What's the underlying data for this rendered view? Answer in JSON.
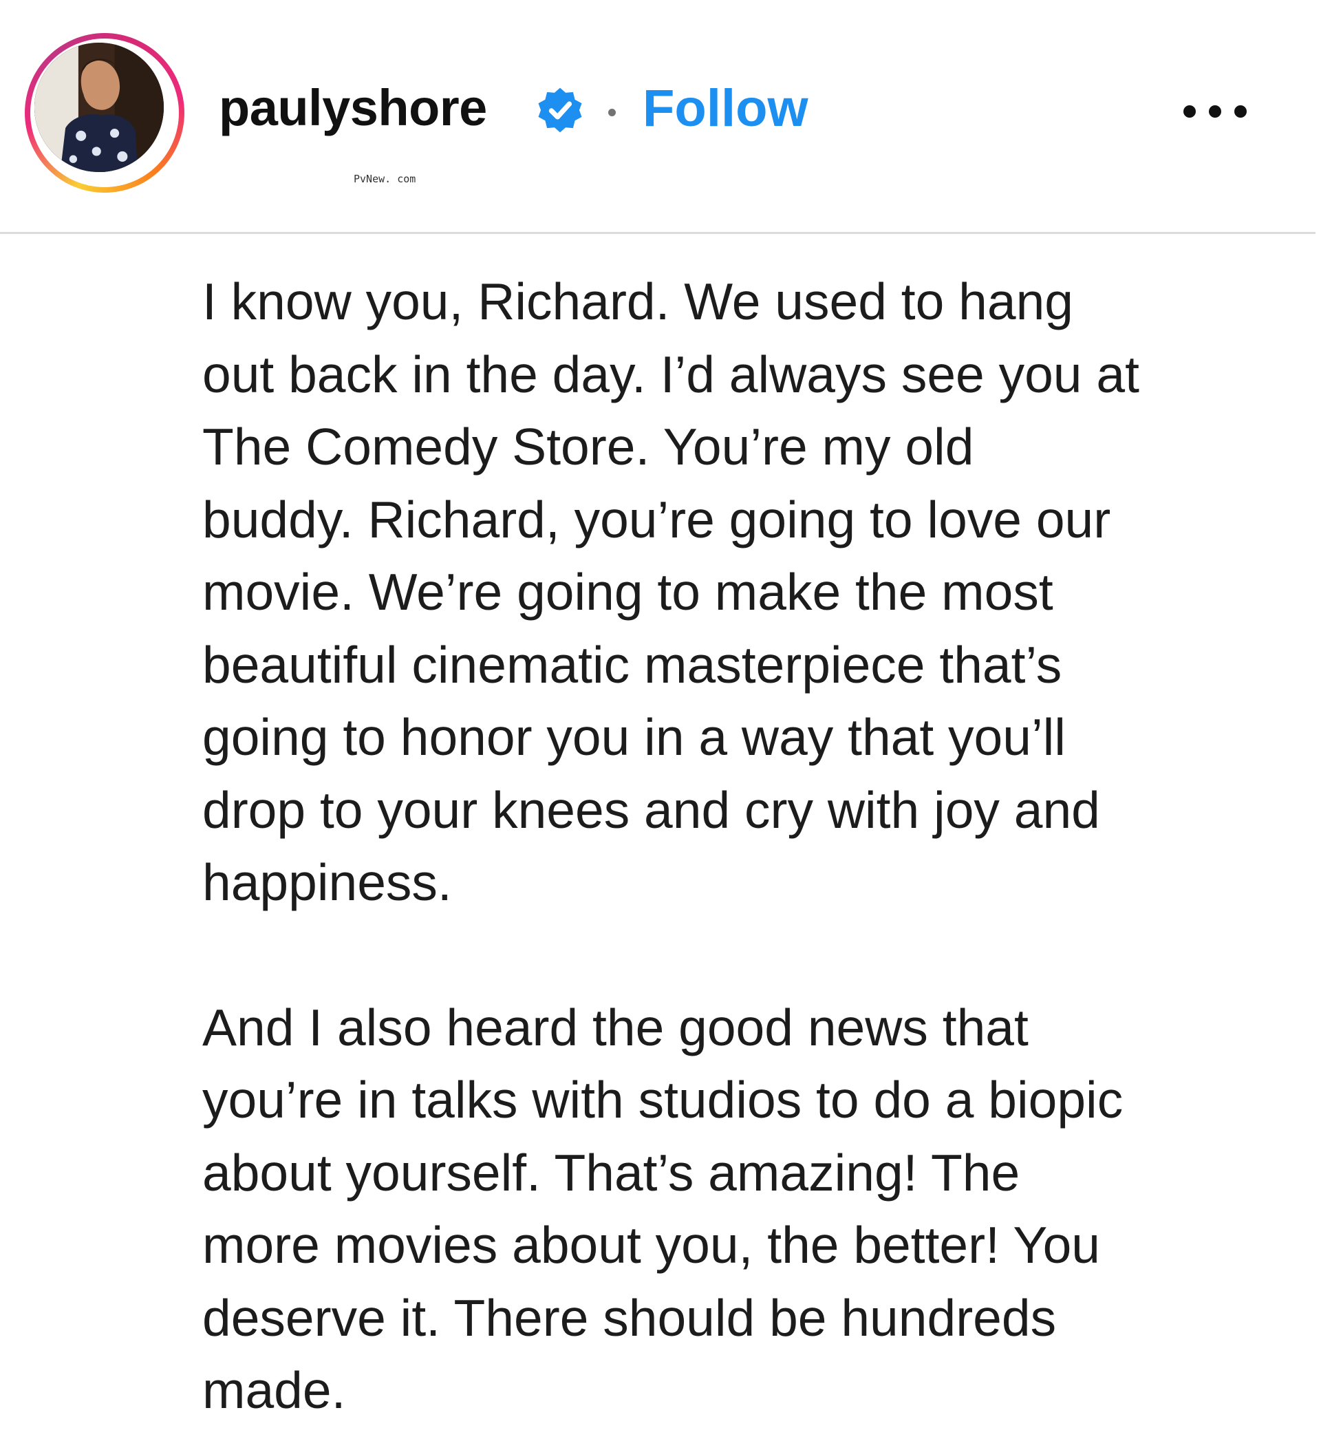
{
  "post": {
    "username": "paulyshore",
    "separator": "•",
    "follow_label": "Follow",
    "watermark": "PvNew. com"
  },
  "icons": {
    "avatar": "profile-photo",
    "verified": "verified-badge-icon",
    "more": "more-options-icon"
  },
  "colors": {
    "follow": "#1d8ff0",
    "verified": "#1d8ff0",
    "divider": "#dbdbdb",
    "text": "#1c1c1c"
  },
  "caption": {
    "paragraph1": [
      "I know you, Richard. We used to hang",
      "out back in the day. I’d always see you at",
      "The Comedy Store. You’re my old",
      "buddy. Richard, you’re going to love our",
      "movie. We’re going to make the most",
      "beautiful cinematic masterpiece that’s",
      "going to honor you in a way that you’ll",
      "drop to your knees and cry with joy and",
      "happiness."
    ],
    "paragraph2": [
      "And I also heard the good news that",
      "you’re in talks with studios to do a biopic",
      "about yourself. That’s amazing! The",
      "more movies about you, the better! You",
      "deserve it. There should be hundreds",
      "made."
    ]
  }
}
